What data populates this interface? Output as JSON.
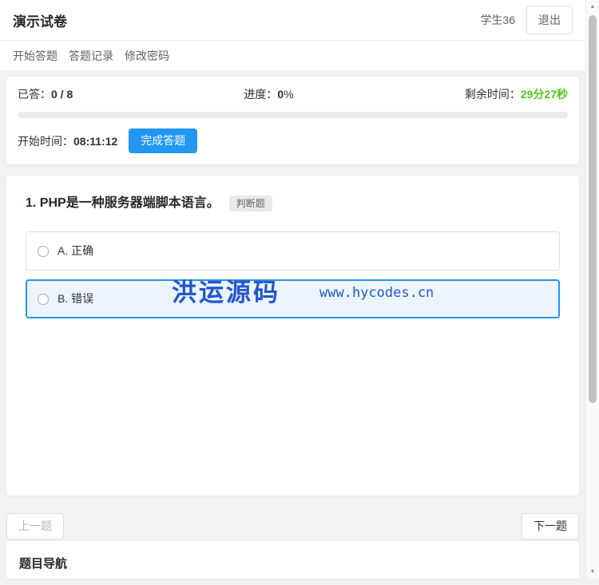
{
  "header": {
    "title": "演示试卷",
    "user": "学生36",
    "logout_label": "退出"
  },
  "nav": {
    "items": [
      {
        "label": "开始答题"
      },
      {
        "label": "答题记录"
      },
      {
        "label": "修改密码"
      }
    ]
  },
  "status": {
    "answered_label": "已答：",
    "answered_value": "0 / 8",
    "progress_label": "进度：",
    "progress_value": "0",
    "progress_unit": "%",
    "progress_percent": 0,
    "time_label": "剩余时间：",
    "time_value": "29分27秒",
    "start_label": "开始时间：",
    "start_value": "08:11:12",
    "finish_button": "完成答题"
  },
  "question": {
    "title": "1. PHP是一种服务器端脚本语言。",
    "type_badge": "判断题",
    "options": [
      {
        "label": "A. 正确",
        "selected": false
      },
      {
        "label": "B. 错误",
        "selected": true
      }
    ]
  },
  "watermark": {
    "text": "洪运源码",
    "url": "www.hycodes.cn"
  },
  "pagination": {
    "prev_label": "上一题",
    "next_label": "下一题"
  },
  "question_nav": {
    "title": "题目导航"
  },
  "scrollbar": {
    "up_glyph": "▲",
    "down_glyph": "▼"
  },
  "colors": {
    "accent_blue": "#2196f3",
    "time_green": "#52c41a",
    "watermark_blue": "#2456cd",
    "selected_option_bg": "#ecf5fe"
  }
}
